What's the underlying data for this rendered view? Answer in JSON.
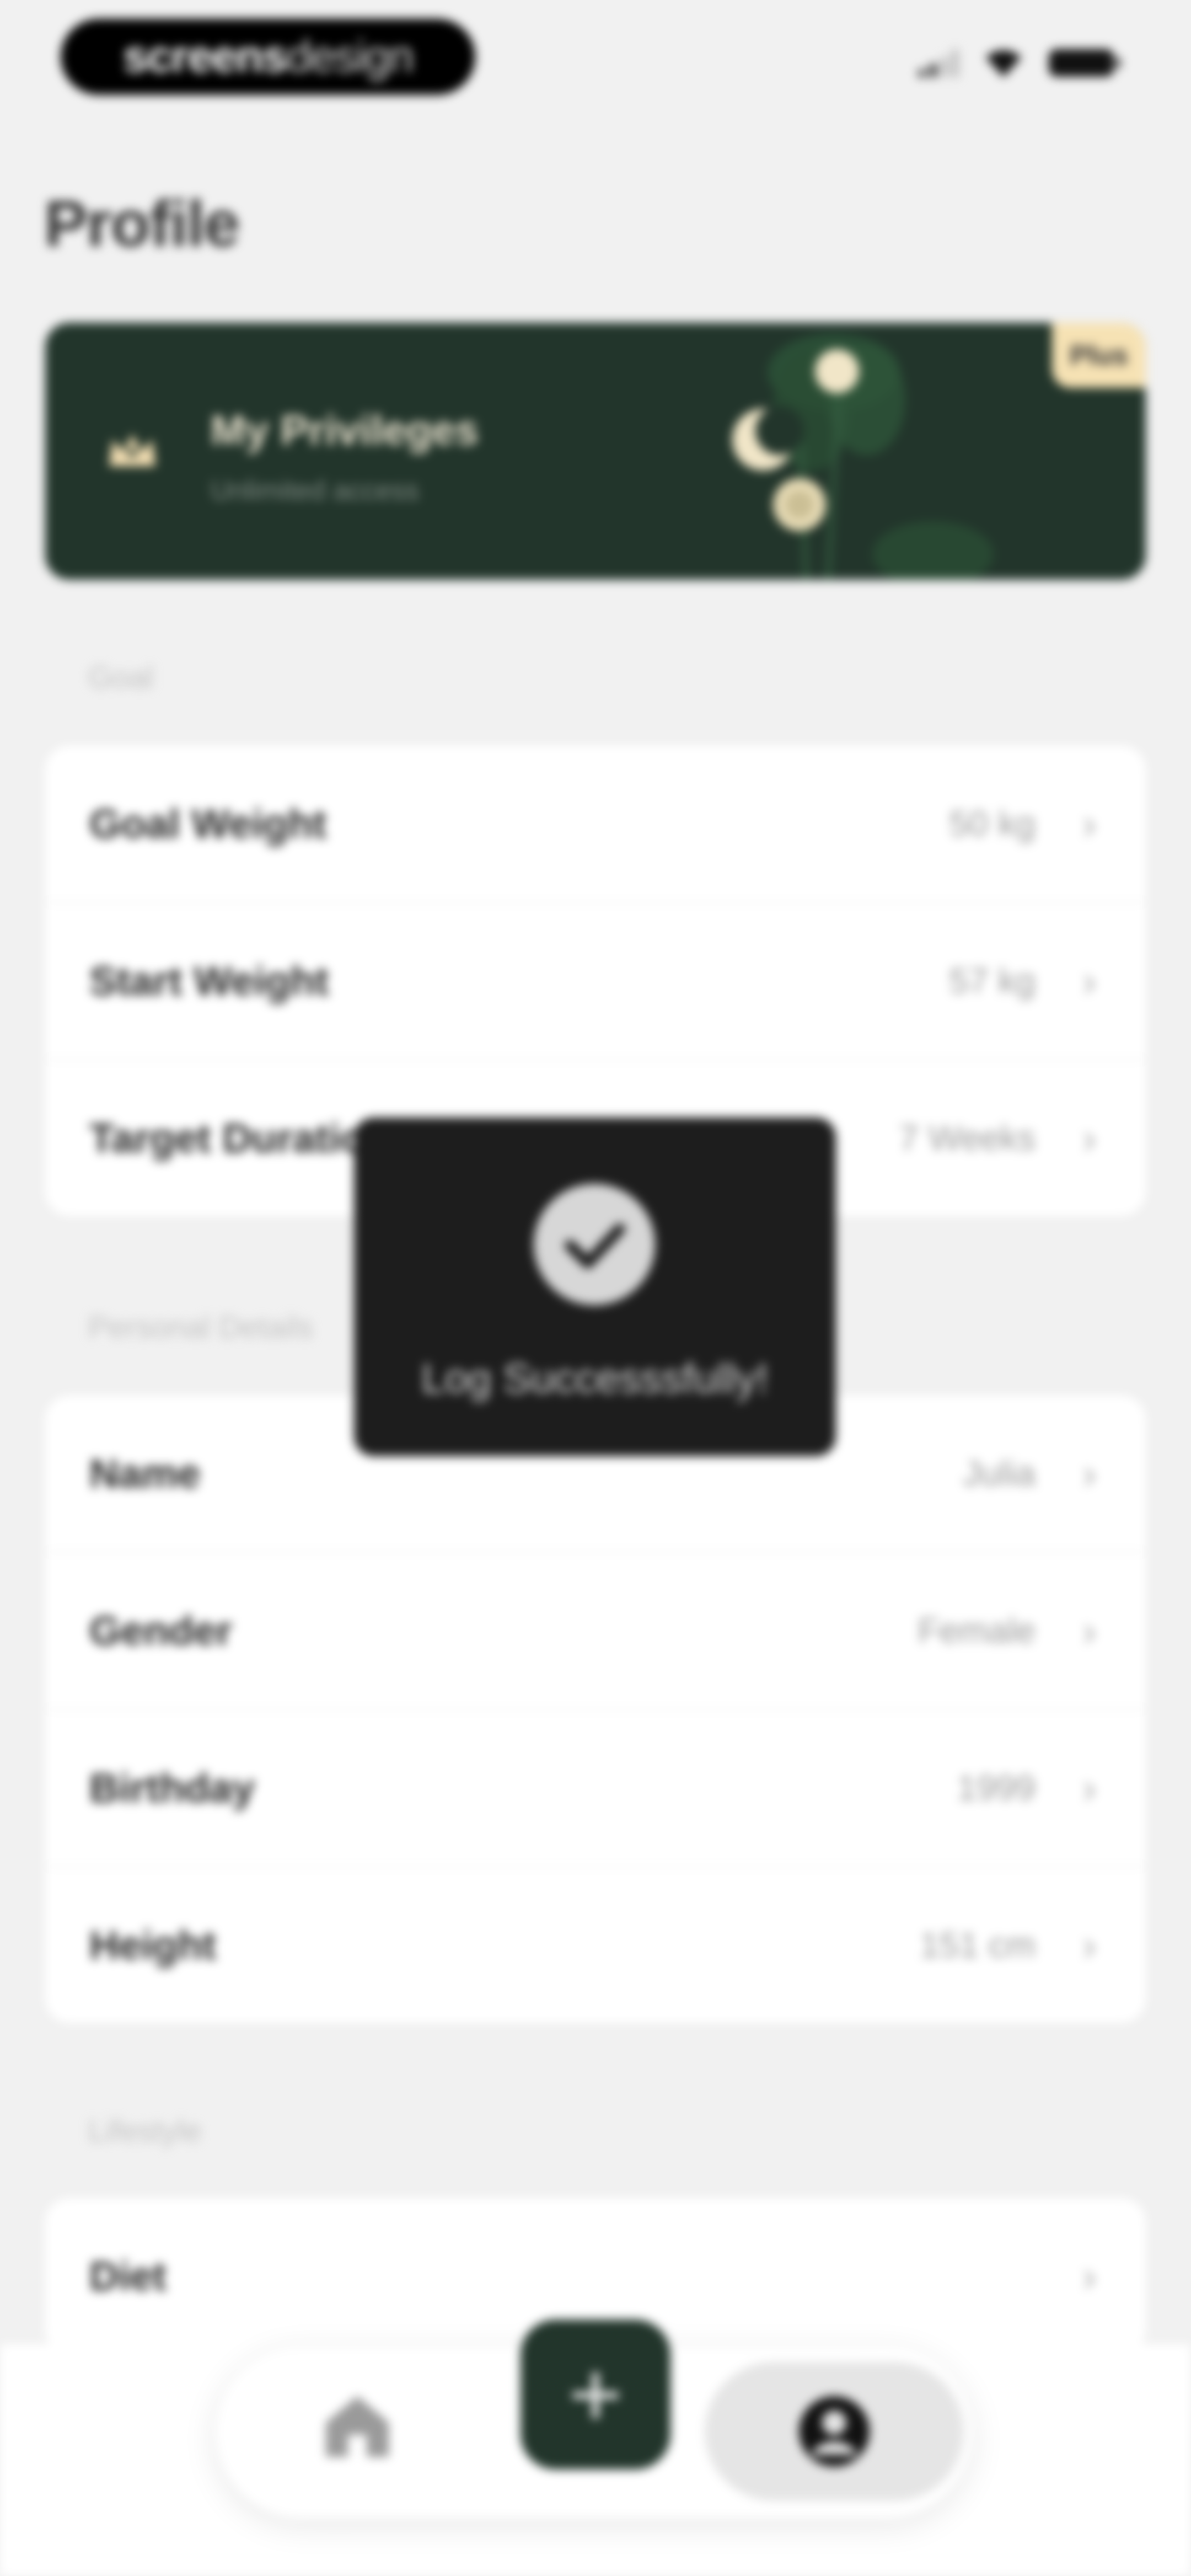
{
  "status_bar": {
    "brand_part1": "screens",
    "brand_part2": "design",
    "icons": [
      "signal-icon",
      "wifi-icon",
      "battery-icon"
    ]
  },
  "header": {
    "title": "Profile"
  },
  "privileges": {
    "title": "My Privileges",
    "subtitle": "Unlimited access",
    "badge": "Plus",
    "icon": "crown-icon"
  },
  "sections": {
    "goal": {
      "header": "Goal",
      "rows": [
        {
          "label": "Goal Weight",
          "value": "50 kg"
        },
        {
          "label": "Start Weight",
          "value": "57 kg"
        },
        {
          "label": "Target Duration",
          "value": "7 Weeks"
        }
      ]
    },
    "personal": {
      "header": "Personal Details",
      "rows": [
        {
          "label": "Name",
          "value": "Julia"
        },
        {
          "label": "Gender",
          "value": "Female"
        },
        {
          "label": "Birthday",
          "value": "1999"
        },
        {
          "label": "Height",
          "value": "151 cm"
        }
      ]
    },
    "lifestyle": {
      "header": "Lifestyle",
      "rows": [
        {
          "label": "Diet",
          "value": ""
        }
      ]
    }
  },
  "toast": {
    "message": "Log Successsfully!",
    "icon": "check-icon"
  },
  "bottom_nav": {
    "items": [
      "home-icon",
      "plus-icon",
      "profile-icon"
    ],
    "active": "profile",
    "add_symbol": "+"
  },
  "colors": {
    "background": "#f1f1f1",
    "brand_green": "#22352b",
    "accent_cream": "#f6e2b4",
    "toast_bg": "#1d1d1d"
  }
}
